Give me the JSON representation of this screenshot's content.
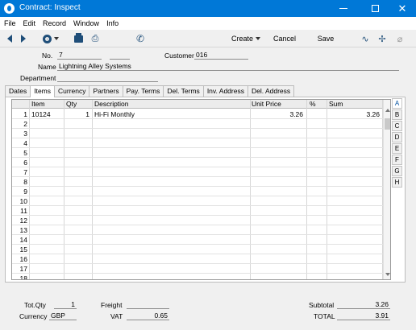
{
  "window": {
    "title": "Contract: Inspect"
  },
  "menu": [
    "File",
    "Edit",
    "Record",
    "Window",
    "Info"
  ],
  "toolbar": {
    "create": "Create",
    "cancel": "Cancel",
    "save": "Save"
  },
  "header": {
    "no_label": "No.",
    "no_value": "7",
    "no_extra": "",
    "customer_label": "Customer",
    "customer_value": "016",
    "name_label": "Name",
    "name_value": "Lightning Alley Systems",
    "department_label": "Department",
    "department_value": ""
  },
  "tabs": [
    "Dates",
    "Items",
    "Currency",
    "Partners",
    "Pay. Terms",
    "Del. Terms",
    "Inv. Address",
    "Del. Address"
  ],
  "active_tab": "Items",
  "grid": {
    "columns": [
      "Item",
      "Qty",
      "Description",
      "Unit Price",
      "%",
      "Sum"
    ],
    "rows": [
      [
        "1",
        "10124",
        "1",
        "Hi-Fi Monthly",
        "3.26",
        "",
        "3.26"
      ],
      [
        "2",
        "",
        "",
        "",
        "",
        "",
        ""
      ],
      [
        "3",
        "",
        "",
        "",
        "",
        "",
        ""
      ],
      [
        "4",
        "",
        "",
        "",
        "",
        "",
        ""
      ],
      [
        "5",
        "",
        "",
        "",
        "",
        "",
        ""
      ],
      [
        "6",
        "",
        "",
        "",
        "",
        "",
        ""
      ],
      [
        "7",
        "",
        "",
        "",
        "",
        "",
        ""
      ],
      [
        "8",
        "",
        "",
        "",
        "",
        "",
        ""
      ],
      [
        "9",
        "",
        "",
        "",
        "",
        "",
        ""
      ],
      [
        "10",
        "",
        "",
        "",
        "",
        "",
        ""
      ],
      [
        "11",
        "",
        "",
        "",
        "",
        "",
        ""
      ],
      [
        "12",
        "",
        "",
        "",
        "",
        "",
        ""
      ],
      [
        "13",
        "",
        "",
        "",
        "",
        "",
        ""
      ],
      [
        "14",
        "",
        "",
        "",
        "",
        "",
        ""
      ],
      [
        "15",
        "",
        "",
        "",
        "",
        "",
        ""
      ],
      [
        "16",
        "",
        "",
        "",
        "",
        "",
        ""
      ],
      [
        "17",
        "",
        "",
        "",
        "",
        "",
        ""
      ],
      [
        "18",
        "",
        "",
        "",
        "",
        "",
        ""
      ]
    ]
  },
  "side_letters": [
    "A",
    "B",
    "C",
    "D",
    "E",
    "F",
    "G",
    "H"
  ],
  "active_letter": "A",
  "footer": {
    "totqty_label": "Tot.Qty",
    "totqty_value": "1",
    "currency_label": "Currency",
    "currency_value": "GBP",
    "freight_label": "Freight",
    "freight_value": "",
    "vat_label": "VAT",
    "vat_value": "0.65",
    "subtotal_label": "Subtotal",
    "subtotal_value": "3.26",
    "total_label": "TOTAL",
    "total_value": "3.91"
  },
  "colors": {
    "titlebar": "#0078d7",
    "icon": "#1f4e79"
  }
}
